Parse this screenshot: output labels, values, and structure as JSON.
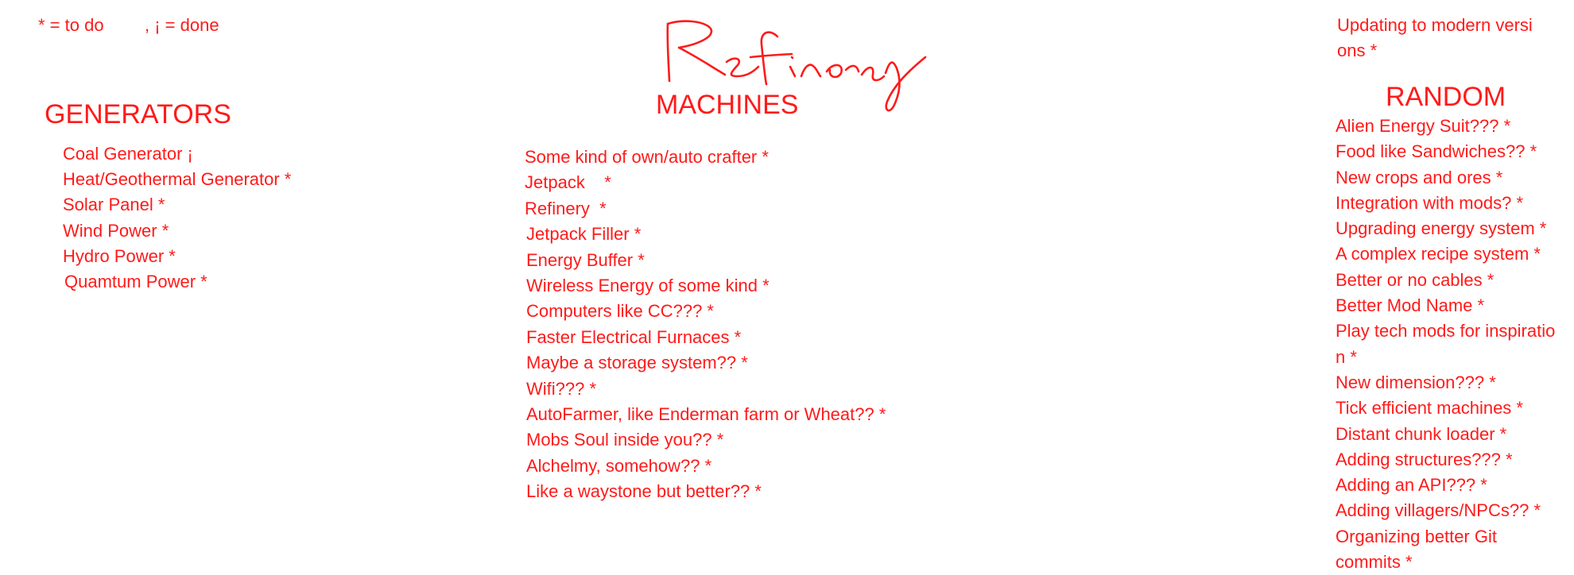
{
  "legend": {
    "todo": "* =  to do",
    "done": ", ¡ =  done"
  },
  "signature_text": "Refinery",
  "colors": {
    "ink": "#ff1a1a",
    "background": "#ffffff"
  },
  "generators": {
    "title": "GENERATORS",
    "items": [
      "Coal Generator ¡",
      "Heat/Geothermal Generator *",
      "Solar Panel *",
      "Wind Power *",
      "Hydro Power *",
      "Quamtum Power *"
    ]
  },
  "machines": {
    "title": "MACHINES",
    "items": [
      "Some kind of own/auto crafter *",
      "Jetpack    *",
      "Refinery  *",
      "Jetpack Filler *",
      "Energy Buffer *",
      "Wireless Energy of some kind *",
      "Computers like CC??? *",
      "Faster Electrical Furnaces *",
      "Maybe a storage system?? *",
      "Wifi??? *",
      "AutoFarmer, like Enderman farm or Wheat?? *",
      "Mobs Soul inside you?? *",
      "Alchelmy, somehow?? *",
      "Like a waystone but better?? *"
    ]
  },
  "random": {
    "updating": "Updating to modern versions *",
    "title": "RANDOM",
    "items": [
      "Alien Energy Suit??? *",
      "Food like Sandwiches?? *",
      "New crops and ores *",
      "Integration with mods? *",
      "Upgrading energy system *",
      "A complex recipe system *",
      "Better or no cables *",
      "Better Mod Name *",
      "Play tech mods for inspiration *",
      "New dimension??? *",
      "Tick efficient machines *",
      "Distant chunk loader *",
      "Adding structures??? *",
      "Adding an API??? *",
      "Adding villagers/NPCs?? *",
      "Organizing better Git commits *"
    ]
  }
}
